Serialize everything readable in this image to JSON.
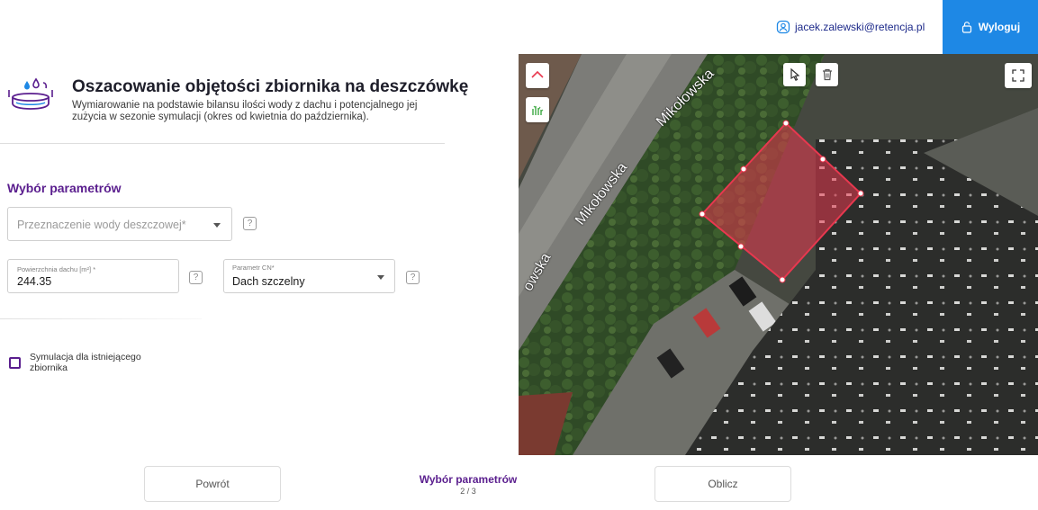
{
  "header": {
    "user_email": "jacek.zalewski@retencja.pl",
    "logout_label": "Wyloguj"
  },
  "intro": {
    "title": "Oszacowanie objętości zbiornika na deszczówkę",
    "description": "Wymiarowanie na podstawie bilansu ilości wody z dachu i potencjalnego jej zużycia w sezonie symulacji (okres od kwietnia do października)."
  },
  "params": {
    "section_title": "Wybór parametrów",
    "purpose_placeholder": "Przeznaczenie wody deszczowej*",
    "roof_area_label": "Powierzchnia dachu [m²] *",
    "roof_area_value": "244.35",
    "cn_label": "Parametr CN*",
    "cn_value": "Dach szczelny",
    "help_symbol": "?",
    "existing_tank_label": "Symulacja dla istniejącego zbiornika",
    "existing_tank_checked": false
  },
  "map": {
    "streets": [
      "Mikołowska",
      "Mikołowska",
      "owska"
    ],
    "polygon_color": "#e8384f",
    "tools": [
      "roof-icon",
      "greenery-icon",
      "select-pointer-icon",
      "trash-icon",
      "fullscreen-icon"
    ]
  },
  "footer": {
    "back_label": "Powrót",
    "step_title": "Wybór parametrów",
    "step_counter": "2 / 3",
    "calc_label": "Oblicz"
  }
}
